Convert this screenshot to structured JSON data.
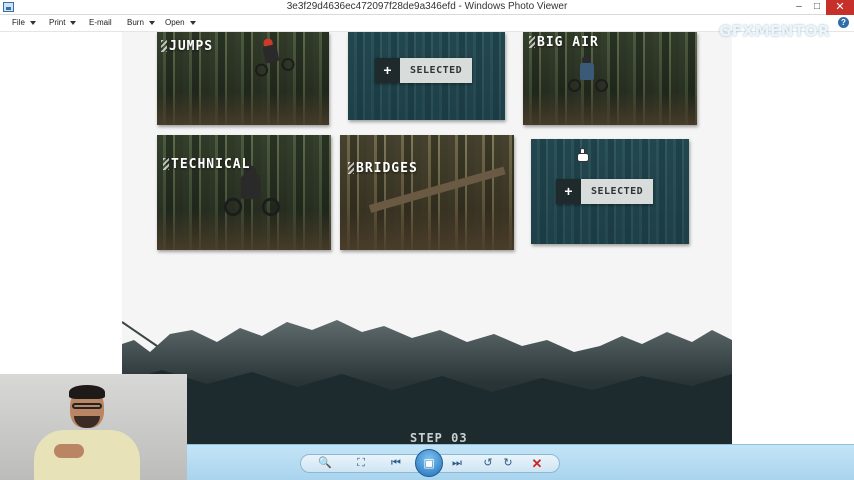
{
  "window": {
    "title": "3e3f29d4636ec472097f28de9a346efd - Windows Photo Viewer",
    "minimize": "–",
    "maximize": "□",
    "close": "✕"
  },
  "menu": {
    "file": "File",
    "print": "Print",
    "email": "E-mail",
    "burn": "Burn",
    "open": "Open",
    "help": "?"
  },
  "design": {
    "tiles": [
      {
        "label": "JUMPS"
      },
      {
        "selected_label": "SELECTED",
        "plus": "+"
      },
      {
        "label": "BIG AIR"
      },
      {
        "label": "TECHNICAL"
      },
      {
        "label": "BRIDGES"
      },
      {
        "selected_label": "SELECTED",
        "plus": "+"
      }
    ],
    "step_label": "STEP 03"
  },
  "watermark": {
    "text": "GFXMENTOR"
  },
  "toolbar": {
    "zoom_icon": "🔍",
    "fit_icon": "⛶",
    "prev_icon": "⏮",
    "slideshow_icon": "▣",
    "next_icon": "⏭",
    "rotate_ccw_icon": "↺",
    "rotate_cw_icon": "↻",
    "delete_icon": "✕"
  },
  "colors": {
    "titlebar_close": "#c7302a",
    "toolbar_bg": "#b9dcf2",
    "design_bg": "#f4f5f4",
    "selected_overlay": "#35545a"
  }
}
